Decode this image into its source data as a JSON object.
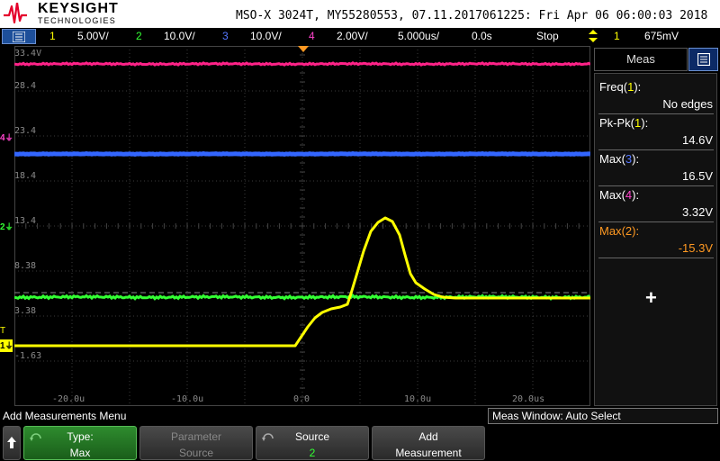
{
  "header": {
    "brand": "KEYSIGHT",
    "brand_sub": "TECHNOLOGIES",
    "scope_info": "MSO-X 3024T, MY55280553, 07.11.2017061225: Fri Apr 06 06:00:03 2018"
  },
  "status_bar": {
    "ch1_num": "1",
    "ch1_scale": "5.00V/",
    "ch2_num": "2",
    "ch2_scale": "10.0V/",
    "ch3_num": "3",
    "ch3_scale": "10.0V/",
    "ch4_num": "4",
    "ch4_scale": "2.00V/",
    "timebase": "5.000us/",
    "delay": "0.0s",
    "run_state": "Stop",
    "trigger_source": "1",
    "trigger_level": "675mV"
  },
  "graticule": {
    "v_labels": [
      "33.4V",
      "28.4",
      "23.4",
      "18.4",
      "13.4",
      "8.38",
      "3.38",
      "-1.63"
    ],
    "h_labels": [
      "-20.0u",
      "-10.0u",
      "0.0",
      "10.0u",
      "20.0us"
    ]
  },
  "markers": {
    "ch4": "4",
    "ch2": "2",
    "trigger": "T",
    "ch1": "1"
  },
  "right_panel": {
    "tab_label": "Meas",
    "measurements": [
      {
        "name": "Freq",
        "ch": "1",
        "value": "No edges",
        "color": "#ffff00"
      },
      {
        "name": "Pk-Pk",
        "ch": "1",
        "value": "14.6V",
        "color": "#ffff00"
      },
      {
        "name": "Max",
        "ch": "3",
        "value": "16.5V",
        "color": "#5577ff"
      },
      {
        "name": "Max",
        "ch": "4",
        "value": "3.32V",
        "color": "#ff44cc"
      },
      {
        "name": "Max",
        "ch": "2",
        "value": "-15.3V",
        "color": "#ff9922"
      }
    ],
    "add_symbol": "+"
  },
  "bottom": {
    "menu_label": "Add Measurements Menu",
    "meas_window": "Meas Window: Auto Select",
    "keys": [
      {
        "line1": "Type:",
        "line2": "Max"
      },
      {
        "line1": "Parameter",
        "line2": "Source"
      },
      {
        "line1": "Source",
        "line2": "2"
      },
      {
        "line1": "Add",
        "line2": "Measurement"
      }
    ]
  },
  "colors": {
    "ch1": "#ffff00",
    "ch2": "#33ff33",
    "ch3": "#3366ff",
    "ch4": "#ff2288",
    "accent": "#1d4f9a"
  }
}
